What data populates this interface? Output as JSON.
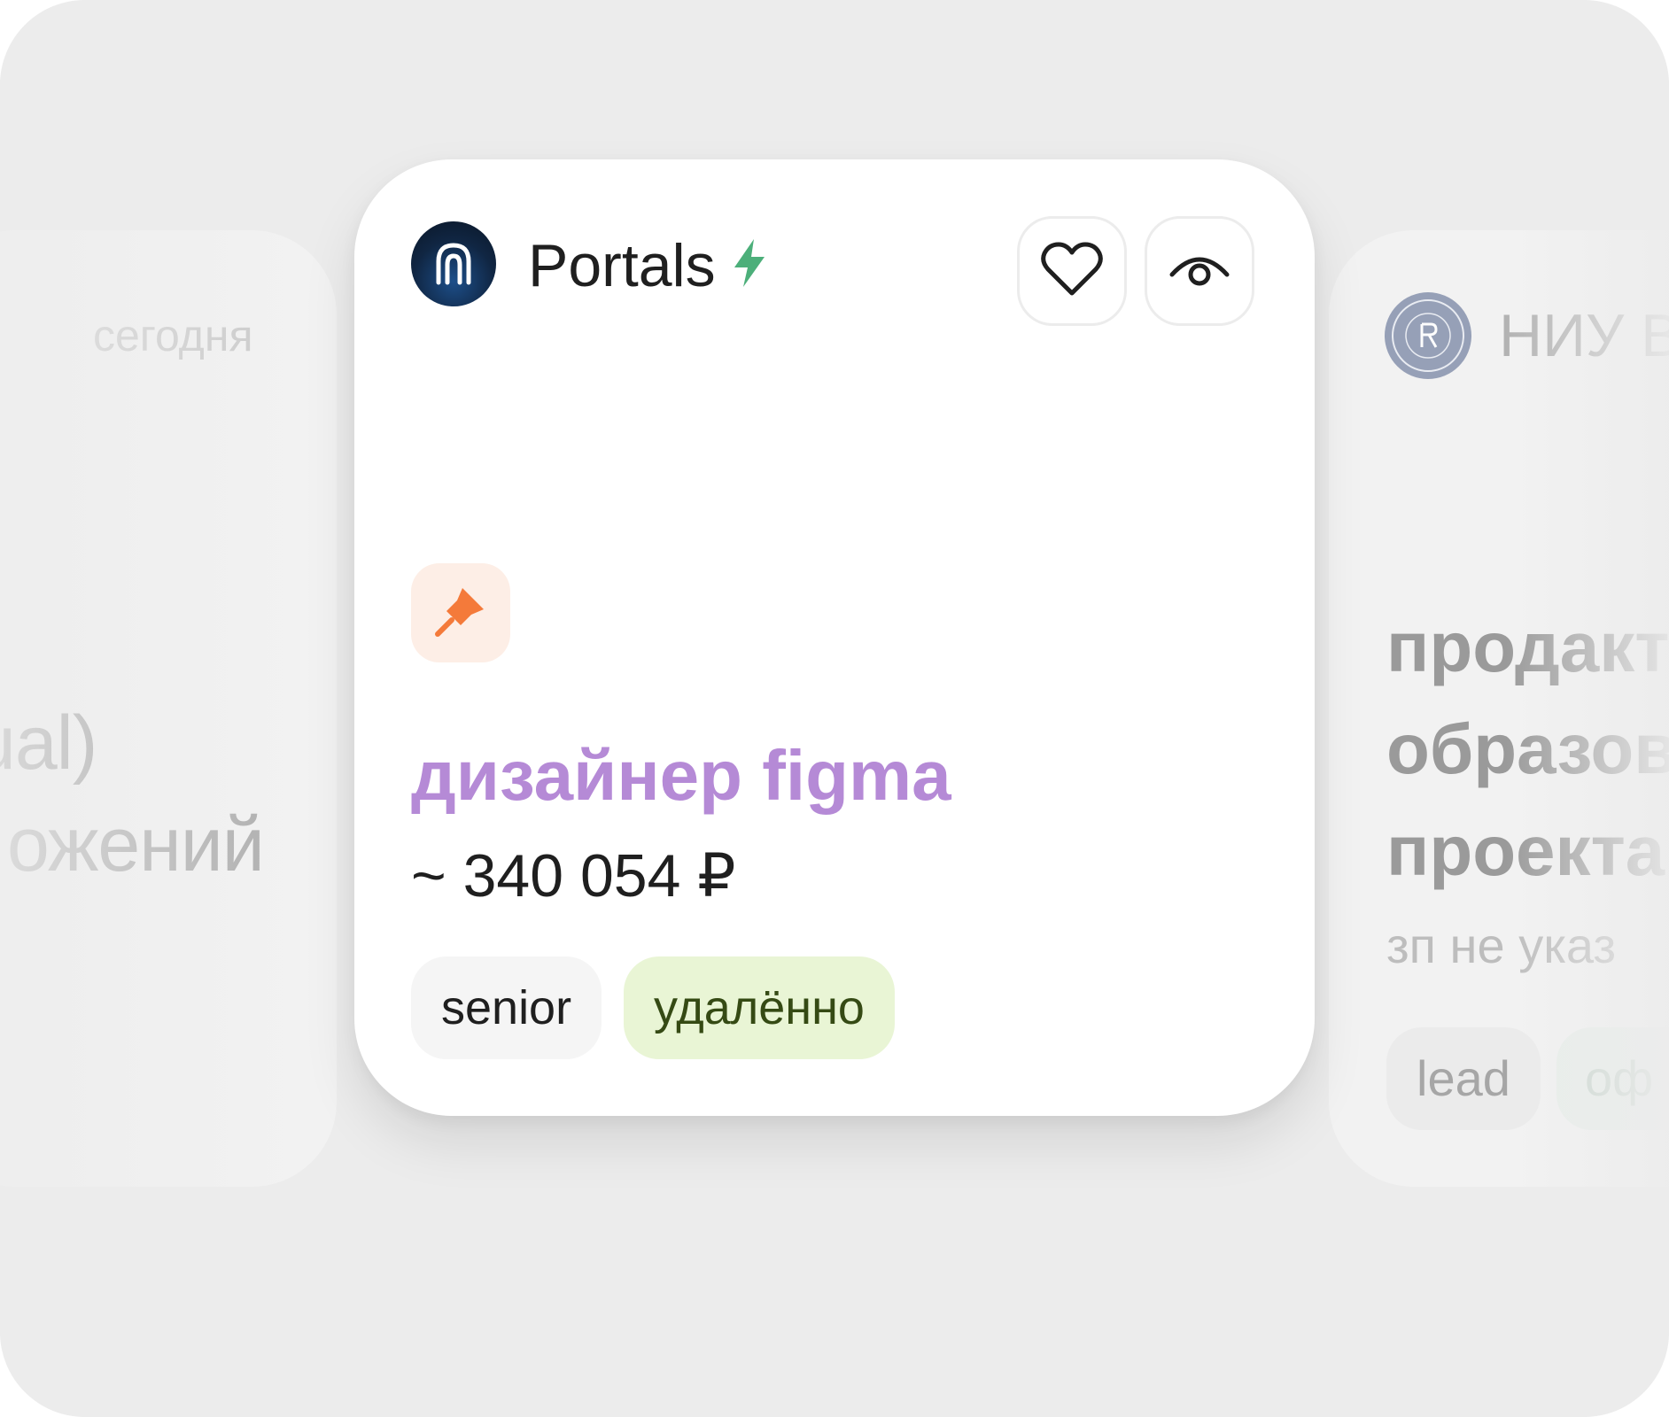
{
  "left_card": {
    "date": "сегодня",
    "title_line1": "ual)",
    "title_line2": "ожений"
  },
  "main_card": {
    "company": "Portals",
    "title": "дизайнер figma",
    "salary": "~ 340 054 ₽",
    "tags": [
      "senior",
      "удалённо"
    ],
    "icons": {
      "logo": "portals-logo-icon",
      "boost": "lightning-icon",
      "like": "heart-icon",
      "view": "eye-icon",
      "badge": "pin-icon"
    },
    "colors": {
      "title": "#b58ad6",
      "boost": "#4caf7a",
      "pin": "#f47a3a",
      "pin_bg": "#fdeee6",
      "remote_tag_bg": "#e9f5d5"
    }
  },
  "right_card": {
    "company": "НИУ В",
    "title_line1": "продакт",
    "title_line2": "образов",
    "title_line3": "проекта",
    "salary": "зп не указ",
    "tags": [
      "lead",
      "оф"
    ]
  }
}
